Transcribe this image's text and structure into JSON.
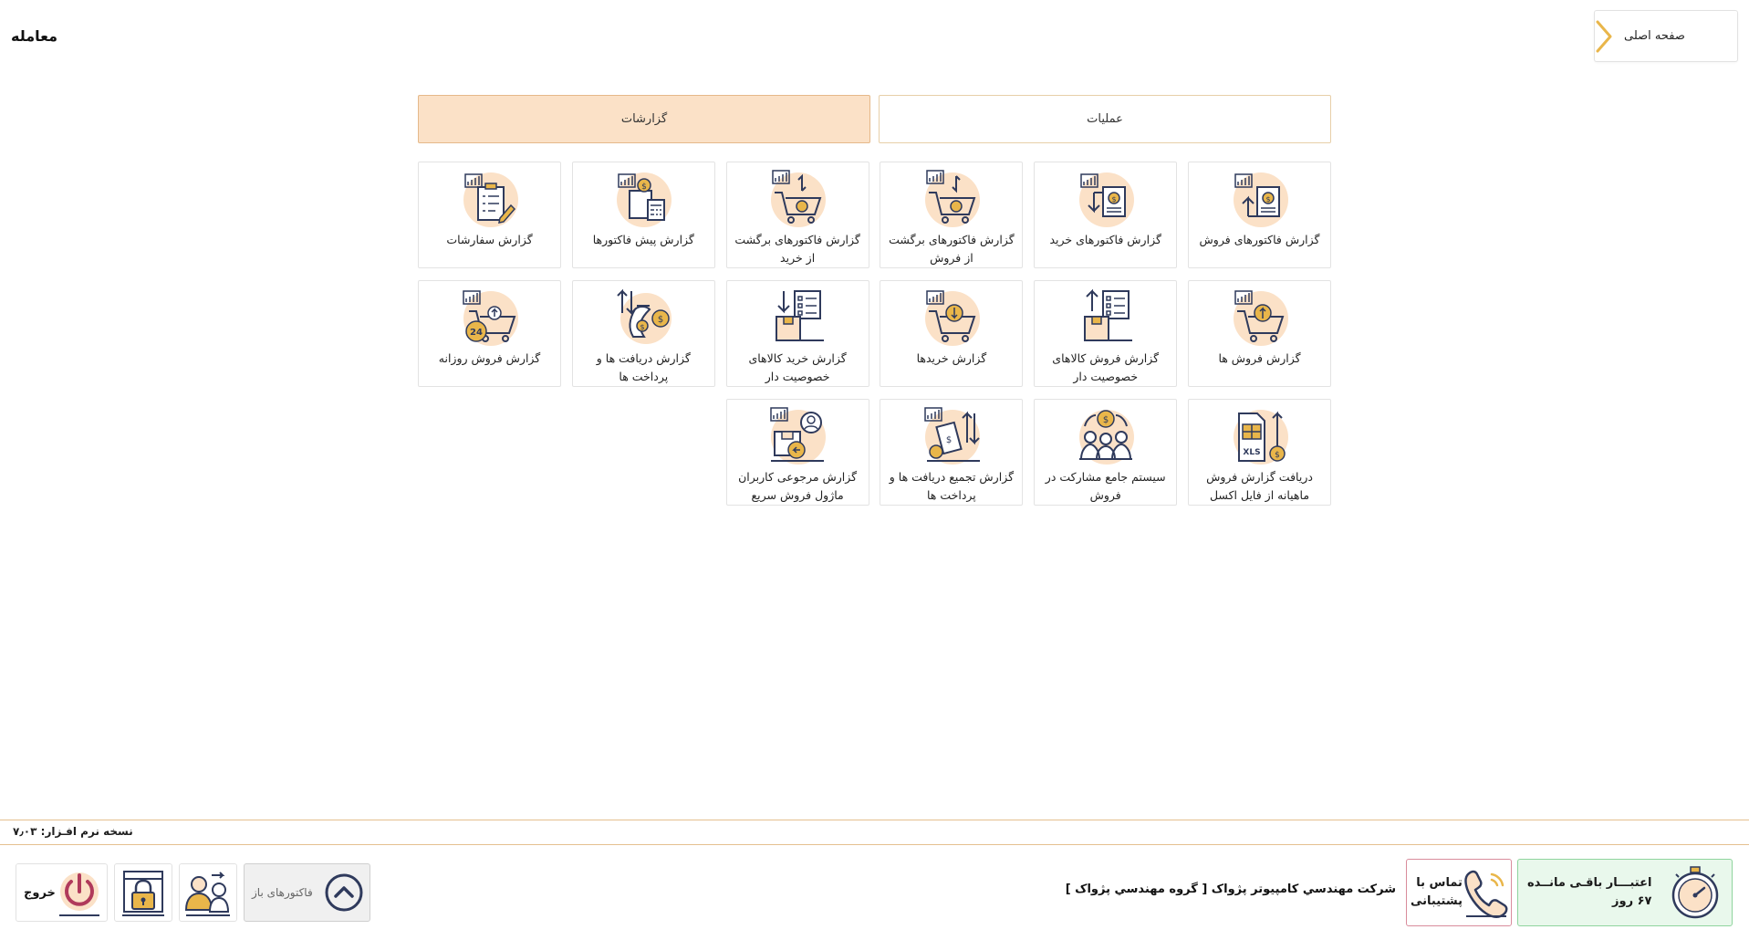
{
  "header": {
    "title": "معامله",
    "home_label": "صفحه اصلی"
  },
  "tabs": [
    {
      "label": "عملیات",
      "active": false
    },
    {
      "label": "گزارشات",
      "active": true
    }
  ],
  "tiles": [
    {
      "label": "گزارش فاکتورهای فروش",
      "icon": "sales-invoice-report-icon"
    },
    {
      "label": "گزارش فاکتورهای خرید",
      "icon": "purchase-invoice-report-icon"
    },
    {
      "label": "گزارش فاکتورهای برگشت از فروش",
      "icon": "sales-return-report-icon"
    },
    {
      "label": "گزارش فاکتورهای برگشت از خرید",
      "icon": "purchase-return-report-icon"
    },
    {
      "label": "گزارش پیش فاکتورها",
      "icon": "proforma-report-icon"
    },
    {
      "label": "گزارش سفارشات",
      "icon": "orders-report-icon"
    },
    {
      "label": "گزارش فروش ها",
      "icon": "sales-report-icon"
    },
    {
      "label": "گزارش فروش کالاهای خصوصیت دار",
      "icon": "featured-goods-sales-report-icon"
    },
    {
      "label": "گزارش خریدها",
      "icon": "purchases-report-icon"
    },
    {
      "label": "گزارش خرید کالاهای خصوصیت دار",
      "icon": "featured-goods-purchase-report-icon"
    },
    {
      "label": "گزارش دریافت ها و پرداخت ها",
      "icon": "receipts-payments-report-icon"
    },
    {
      "label": "گزارش فروش روزانه",
      "icon": "daily-sales-report-icon"
    },
    {
      "label": "دریافت گزارش فروش ماهیانه از فایل اکسل",
      "icon": "excel-monthly-report-icon"
    },
    {
      "label": "سیستم جامع مشارکت در فروش",
      "icon": "sales-partnership-icon"
    },
    {
      "label": "گزارش تجمیع دریافت ها و پرداخت ها",
      "icon": "aggregate-payments-report-icon"
    },
    {
      "label": "گزارش مرجوعی کاربران ماژول فروش سریع",
      "icon": "user-returns-report-icon"
    }
  ],
  "footer": {
    "version": "نسخه نرم افـزار: ۷٫۰۳",
    "credit_line1": "اعتبـــار باقـی مانــده",
    "credit_line2": "۶۷ روز",
    "support_line1": "تماس با",
    "support_line2": "پشتیبانی",
    "company": "شركت مهندسي كامپيوتر پژواک [ گروه مهندسي پژواک ]",
    "open_invoices": "فاکتورهای باز",
    "exit": "خروج"
  },
  "colors": {
    "accent": "#e9b64a",
    "navy": "#2f3a5c",
    "peach": "#fbe1c7",
    "credit_bg": "#e9f8ec"
  }
}
